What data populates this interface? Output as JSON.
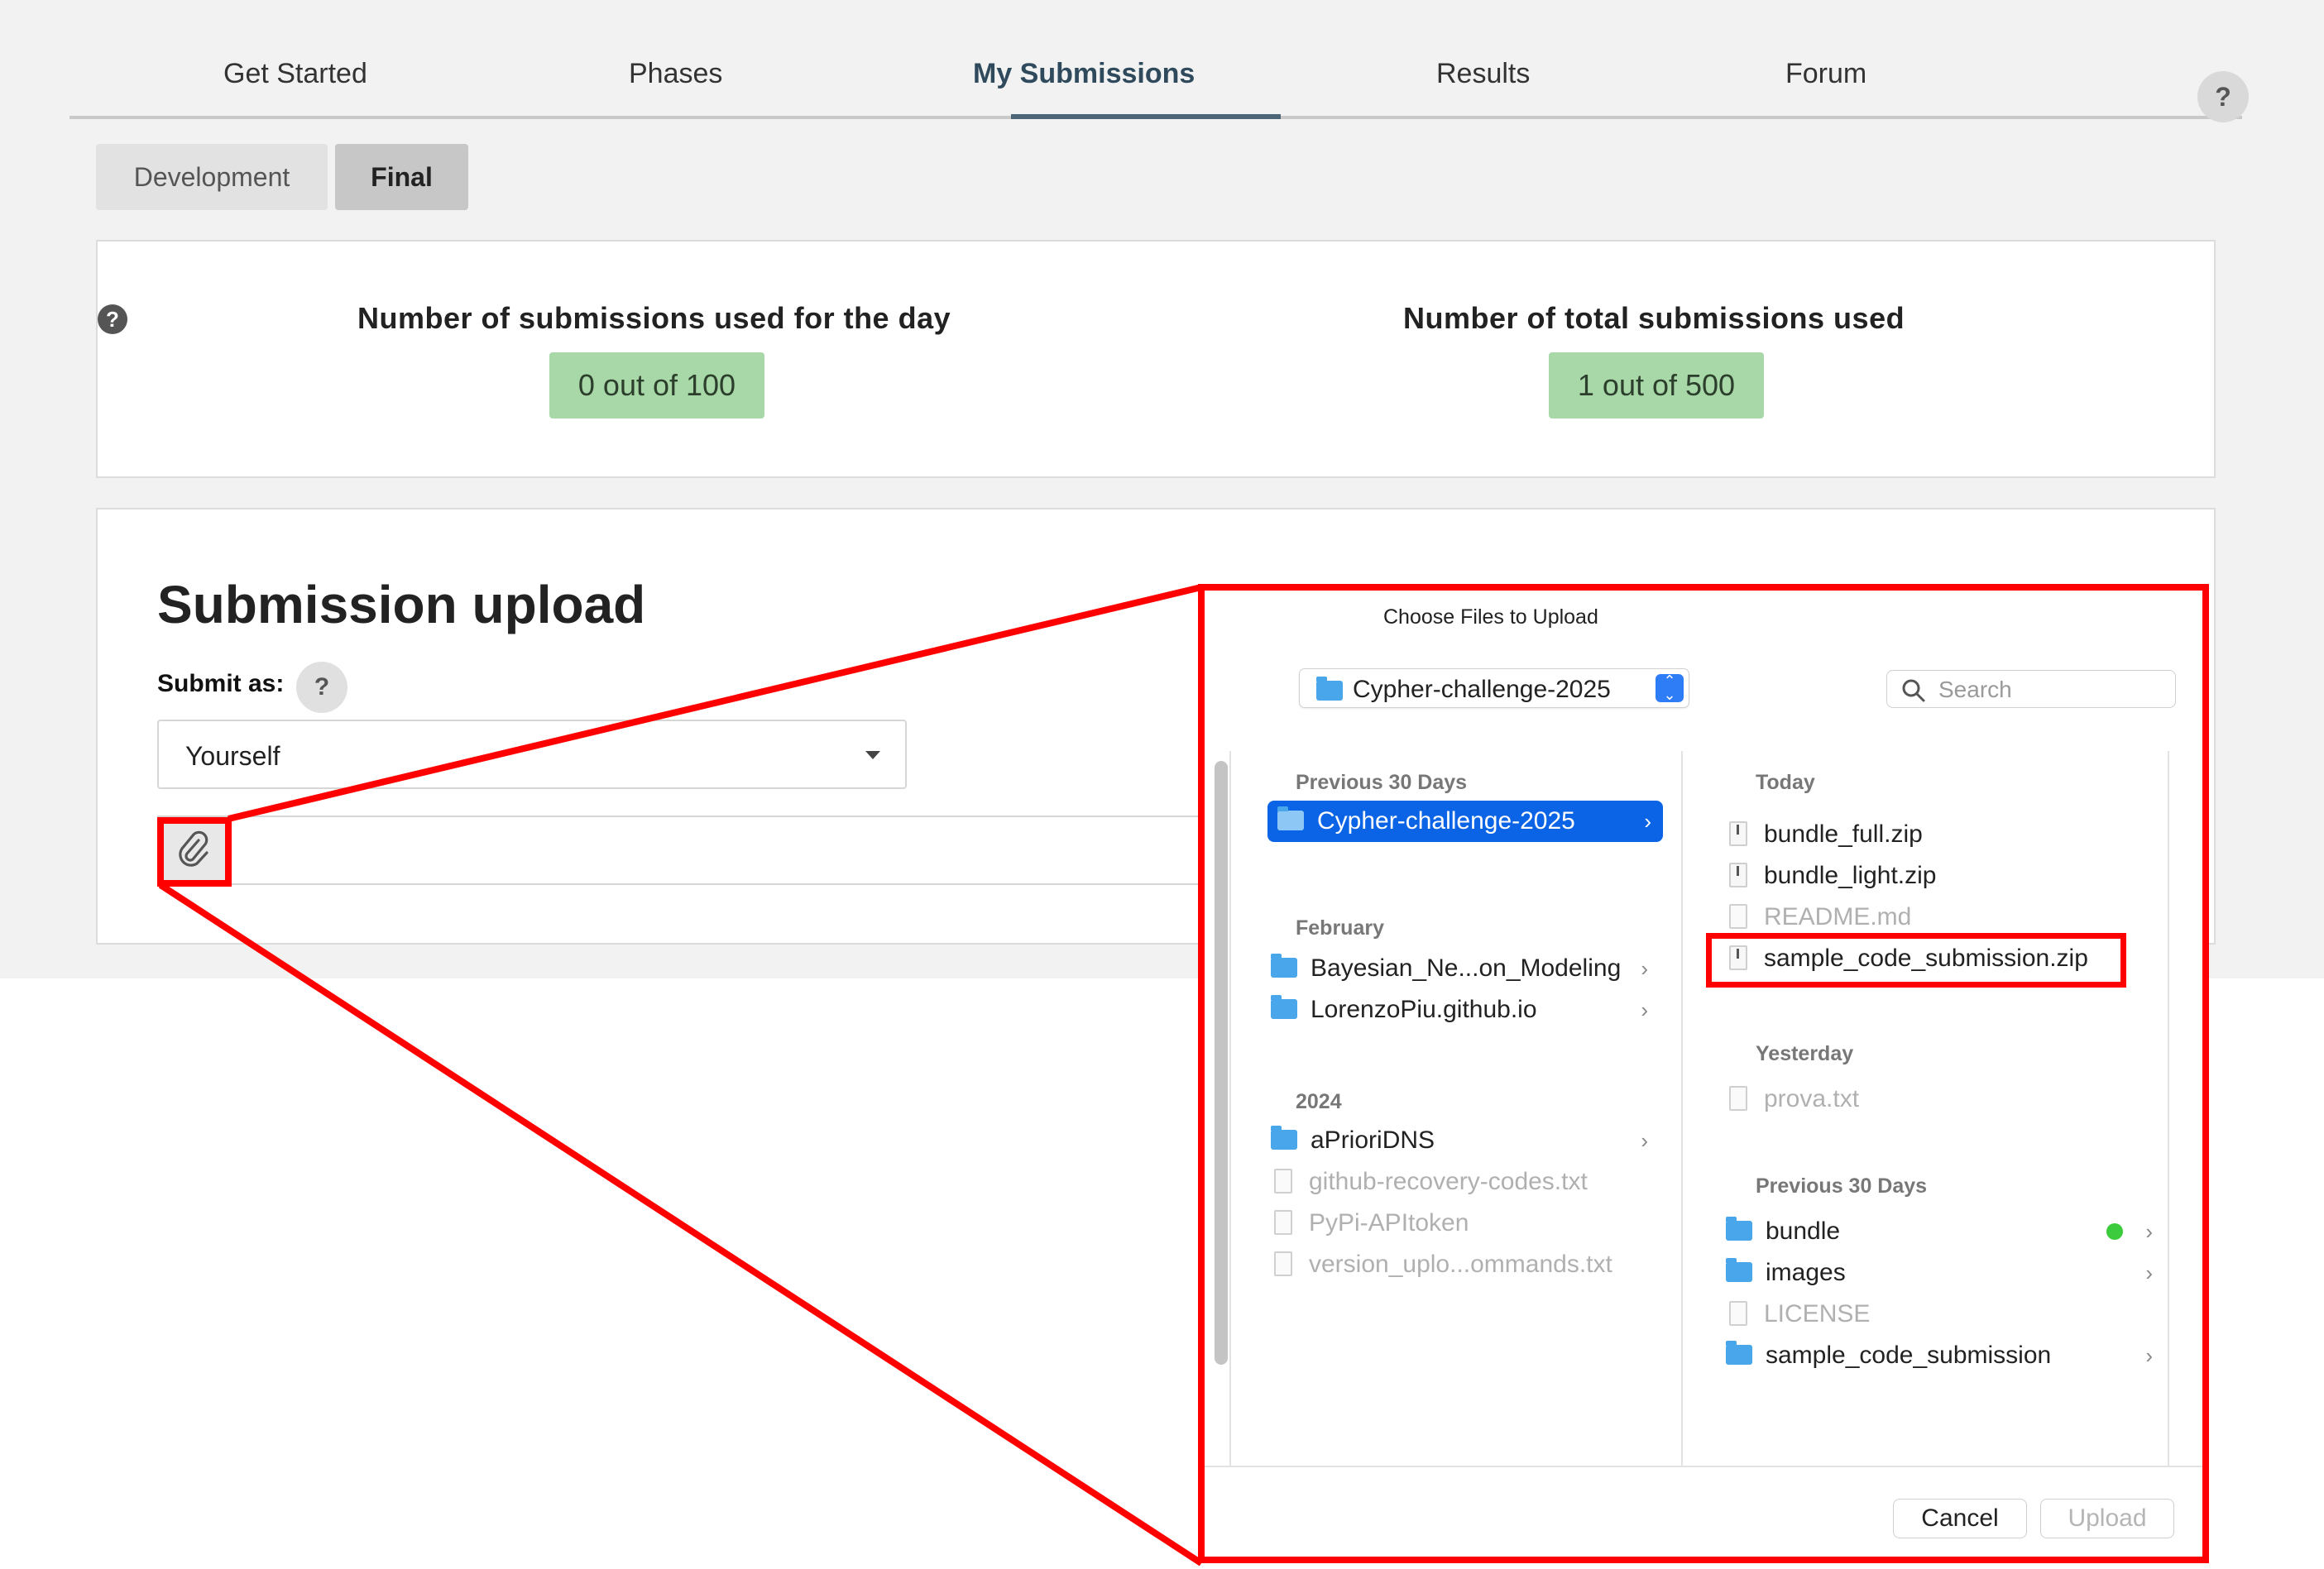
{
  "nav": {
    "items": [
      "Get Started",
      "Phases",
      "My Submissions",
      "Results",
      "Forum"
    ],
    "active": "My Submissions",
    "help": "?"
  },
  "phases": {
    "development": "Development",
    "final": "Final",
    "selected": "Final"
  },
  "counters": {
    "help": "?",
    "daily_title": "Number of submissions used for the day",
    "daily_value": "0 out of 100",
    "total_title": "Number of total submissions used",
    "total_value": "1 out of 500"
  },
  "upload": {
    "title": "Submission upload",
    "submit_as_label": "Submit as:",
    "submit_as_help": "?",
    "submit_as_value": "Yourself"
  },
  "dialog": {
    "title": "Choose Files to Upload",
    "location": "Cypher-challenge-2025",
    "search_placeholder": "Search",
    "left": {
      "sections": [
        {
          "label": "Previous 30 Days",
          "items": [
            {
              "name": "Cypher-challenge-2025",
              "kind": "folder",
              "selected": true,
              "chevron": "›"
            }
          ]
        },
        {
          "label": "February",
          "items": [
            {
              "name": "Bayesian_Ne...on_Modeling",
              "kind": "folder",
              "chevron": "›"
            },
            {
              "name": "LorenzoPiu.github.io",
              "kind": "folder",
              "chevron": "›"
            }
          ]
        },
        {
          "label": "2024",
          "items": [
            {
              "name": "aPrioriDNS",
              "kind": "folder",
              "chevron": "›"
            },
            {
              "name": "github-recovery-codes.txt",
              "kind": "file",
              "dim": true
            },
            {
              "name": "PyPi-APItoken",
              "kind": "file",
              "dim": true
            },
            {
              "name": "version_uplo...ommands.txt",
              "kind": "file",
              "dim": true
            }
          ]
        }
      ]
    },
    "right": {
      "sections": [
        {
          "label": "Today",
          "items": [
            {
              "name": "bundle_full.zip",
              "kind": "zip"
            },
            {
              "name": "bundle_light.zip",
              "kind": "zip"
            },
            {
              "name": "README.md",
              "kind": "file",
              "dim": true
            },
            {
              "name": "sample_code_submission.zip",
              "kind": "zip",
              "highlighted": true
            }
          ]
        },
        {
          "label": "Yesterday",
          "items": [
            {
              "name": "prova.txt",
              "kind": "file",
              "dim": true
            }
          ]
        },
        {
          "label": "Previous 30 Days",
          "items": [
            {
              "name": "bundle",
              "kind": "folder",
              "chevron": "›",
              "tag": "green"
            },
            {
              "name": "images",
              "kind": "folder",
              "chevron": "›"
            },
            {
              "name": "LICENSE",
              "kind": "file",
              "dim": true
            },
            {
              "name": "sample_code_submission",
              "kind": "folder",
              "chevron": "›"
            }
          ]
        }
      ]
    },
    "cancel_label": "Cancel",
    "upload_label": "Upload",
    "colors": {
      "selection": "#0b63e5",
      "annotation": "#ff0000",
      "counter_badge": "#a8d8a8"
    }
  }
}
